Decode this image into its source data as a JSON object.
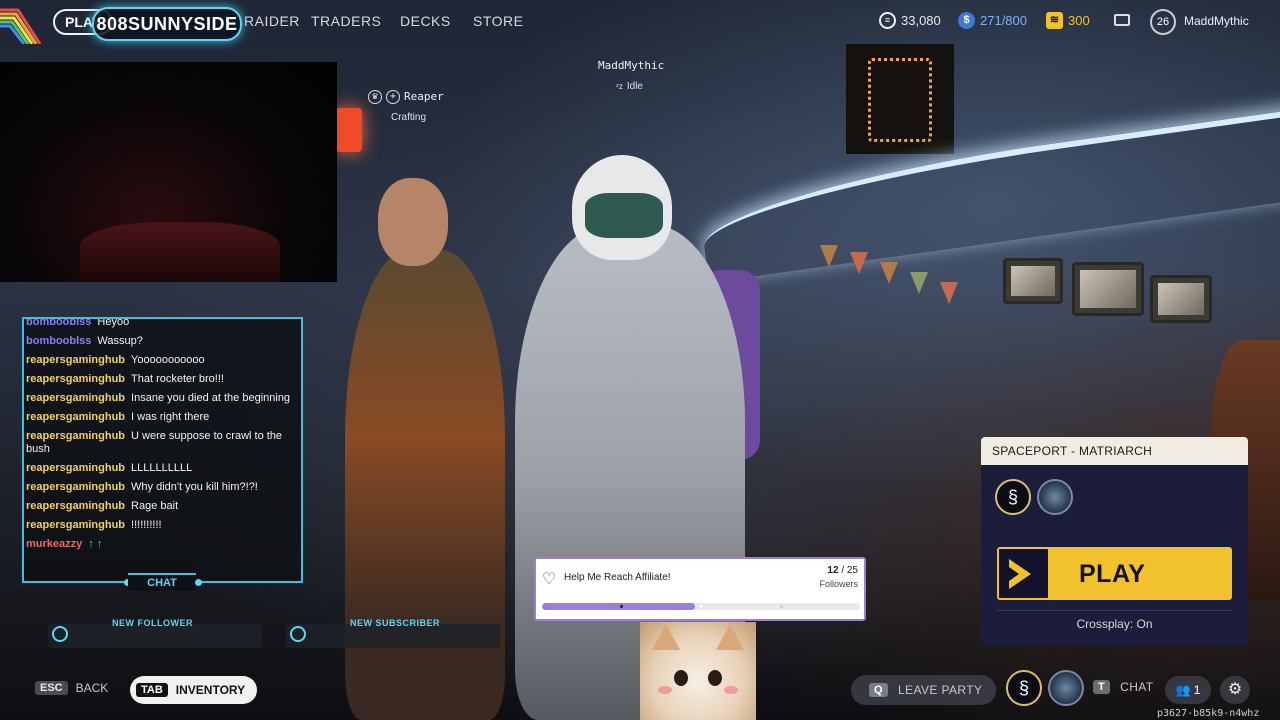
{
  "topbar": {
    "nav": [
      "PLAY",
      "RAIDER",
      "TRADERS",
      "DECKS",
      "STORE"
    ],
    "channel_badge": "808SUNNYSIDE",
    "currencies": [
      {
        "icon": "coins-icon",
        "value": "33,080"
      },
      {
        "icon": "raider-token-icon",
        "value": "271/800"
      },
      {
        "icon": "credits-icon",
        "value": "300"
      }
    ],
    "level": "26",
    "username": "MaddMythic"
  },
  "party": {
    "player": {
      "name": "MaddMythic",
      "status": "Idle"
    },
    "member": {
      "name": "Reaper",
      "status": "Crafting"
    }
  },
  "chat": {
    "label": "CHAT",
    "messages": [
      {
        "user": "bombooblss",
        "text": "Heyoo",
        "color": "blue"
      },
      {
        "user": "bombooblss",
        "text": "Wassup?",
        "color": "blue"
      },
      {
        "user": "reapersgaminghub",
        "text": "Yooooooooooo",
        "color": "gold"
      },
      {
        "user": "reapersgaminghub",
        "text": "That rocketer bro!!!",
        "color": "gold"
      },
      {
        "user": "reapersgaminghub",
        "text": "Insane you died at the beginning",
        "color": "gold"
      },
      {
        "user": "reapersgaminghub",
        "text": "I was right there",
        "color": "gold"
      },
      {
        "user": "reapersgaminghub",
        "text": "U were suppose to crawl to the bush",
        "color": "gold"
      },
      {
        "user": "reapersgaminghub",
        "text": "LLLLLLLLLL",
        "color": "gold"
      },
      {
        "user": "reapersgaminghub",
        "text": "Why didn't you kill him?!?!",
        "color": "gold"
      },
      {
        "user": "reapersgaminghub",
        "text": "Rage bait",
        "color": "gold"
      },
      {
        "user": "reapersgaminghub",
        "text": "!!!!!!!!!!",
        "color": "gold"
      },
      {
        "user": "murkeazzy",
        "text": "↑ ↑",
        "color": "red"
      }
    ]
  },
  "alerts": {
    "new_follower": "NEW FOLLOWER",
    "new_subscriber": "NEW SUBSCRIBER"
  },
  "goal": {
    "title": "Help Me Reach Affiliate!",
    "current": "12",
    "target": "/ 25",
    "unit": "Followers",
    "progress": 0.48
  },
  "mission": {
    "location": "SPACEPORT - MATRIARCH",
    "play_label": "PLAY",
    "crossplay": "Crossplay: On"
  },
  "bottombar": {
    "back_key": "ESC",
    "back_label": "BACK",
    "inventory_key": "TAB",
    "inventory_label": "INVENTORY",
    "leave_key": "Q",
    "leave_label": "LEAVE PARTY",
    "chat_key": "T",
    "chat_label": "CHAT",
    "friends_count": "1",
    "build_id": "p3627-b85k9-n4whz"
  },
  "colors": {
    "accent_yellow": "#f2c12e",
    "overlay_cyan": "#3fbfe0",
    "goal_purple": "#9b7fd6",
    "panel_navy": "#1b1d3a"
  }
}
